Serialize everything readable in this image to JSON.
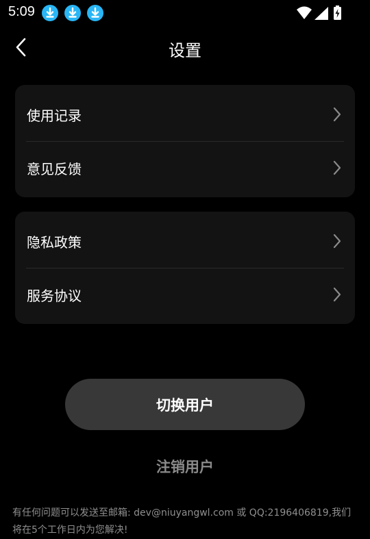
{
  "status_bar": {
    "time": "5:09",
    "notification_icons": [
      "download-icon",
      "download-icon",
      "download-icon"
    ],
    "system_icons": [
      "wifi-icon",
      "signal-icon",
      "battery-charging-icon"
    ]
  },
  "header": {
    "title": "设置",
    "back_icon": "back-arrow-icon"
  },
  "settings_groups": [
    {
      "items": [
        {
          "label": "使用记录",
          "icon": "chevron-right-icon"
        },
        {
          "label": "意见反馈",
          "icon": "chevron-right-icon"
        }
      ]
    },
    {
      "items": [
        {
          "label": "隐私政策",
          "icon": "chevron-right-icon"
        },
        {
          "label": "服务协议",
          "icon": "chevron-right-icon"
        }
      ]
    }
  ],
  "actions": {
    "switch_user_label": "切换用户",
    "logout_label": "注销用户"
  },
  "footer": {
    "note": "有任何问题可以发送至邮箱: dev@niuyangwl.com 或 QQ:2196406819,我们将在5个工作日内为您解决!"
  },
  "colors": {
    "background": "#000000",
    "card": "#131313",
    "primary_button": "#383838",
    "download_badge": "#29b6f6",
    "muted_text": "#8f8f8f"
  }
}
